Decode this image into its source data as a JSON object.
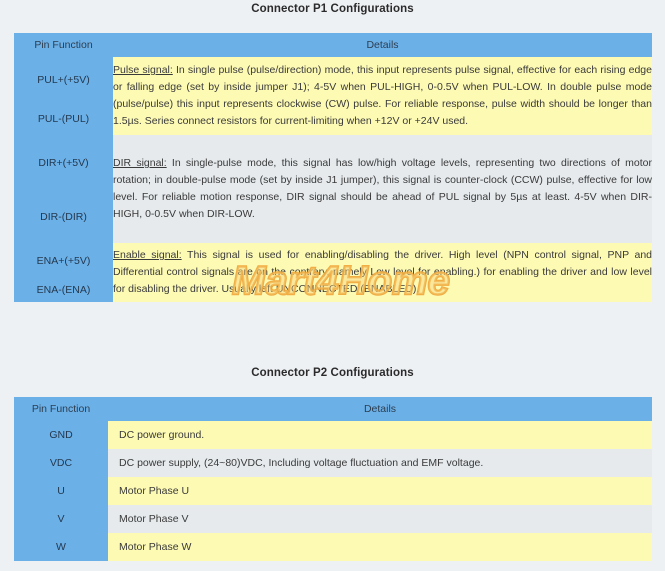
{
  "sections": [
    {
      "id": "p1",
      "title": "Connector P1 Configurations",
      "columns": {
        "pin": "Pin Function",
        "details": "Details"
      },
      "groups": [
        {
          "pins": [
            "PUL+(+5V)",
            "PUL-(PUL)"
          ],
          "shade": "yellow",
          "lead": "Pulse signal:",
          "detail": " In single pulse (pulse/direction) mode, this input represents pulse signal, effective for each rising edge or falling edge (set by inside jumper J1); 4-5V when PUL-HIGH, 0-0.5V when PUL-LOW. In double pulse mode (pulse/pulse) this input represents clockwise (CW) pulse. For reliable response, pulse width should be longer than 1.5µs. Series connect resistors for current-limiting when +12V or +24V used."
        },
        {
          "pins": [
            "DIR+(+5V)",
            "DIR-(DIR)"
          ],
          "shade": "gray",
          "lead": "DIR signal:",
          "detail": " In single-pulse mode, this signal has low/high voltage levels, representing two directions of motor rotation; in double-pulse mode (set by inside J1 jumper), this signal is counter-clock (CCW) pulse, effective for low level. For reliable motion response, DIR signal should be ahead of PUL signal by 5µs at least. 4-5V when DIR-HIGH, 0-0.5V when DIR-LOW."
        },
        {
          "pins": [
            "ENA+(+5V)",
            "ENA-(ENA)"
          ],
          "shade": "yellow",
          "lead": "Enable signal:",
          "detail": " This signal is used for enabling/disabling the driver. High level (NPN control signal, PNP and Differential control signals are on the contrary, namely Low level for enabling.) for enabling the driver and low level for disabling the driver. Usually left UNCONNECTED (ENABLED)."
        }
      ]
    },
    {
      "id": "p2",
      "title": "Connector P2 Configurations",
      "columns": {
        "pin": "Pin Function",
        "details": "Details"
      },
      "rows": [
        {
          "pin": "GND",
          "shade": "yellow",
          "detail": "DC power ground."
        },
        {
          "pin": "VDC",
          "shade": "gray",
          "detail": "DC power supply, (24~80)VDC, Including voltage fluctuation and EMF voltage."
        },
        {
          "pin": "U",
          "shade": "yellow",
          "detail": "Motor Phase U"
        },
        {
          "pin": "V",
          "shade": "gray",
          "detail": "Motor Phase V"
        },
        {
          "pin": "W",
          "shade": "yellow",
          "detail": "Motor Phase W"
        }
      ]
    }
  ],
  "watermark": {
    "text": "Mart4Home",
    "color": "#f0a83c"
  },
  "colors": {
    "header_blue": "#6cb0e8",
    "row_yellow": "#fdfab4",
    "row_gray": "#e6eaed",
    "page_background": "#eef1f4"
  }
}
